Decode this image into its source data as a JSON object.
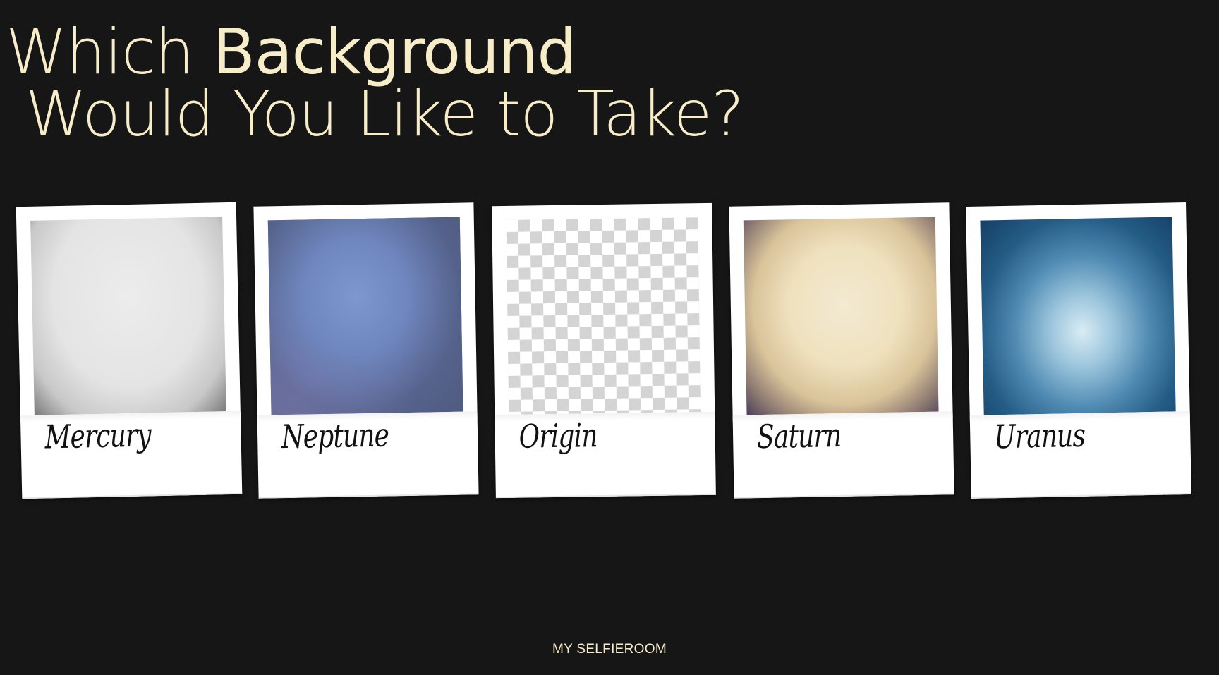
{
  "heading": {
    "line1_prefix": "Which ",
    "line1_emphasis": "Background",
    "line2": "Would You Like to Take?"
  },
  "backgrounds": [
    {
      "label": "Mercury"
    },
    {
      "label": "Neptune"
    },
    {
      "label": "Origin"
    },
    {
      "label": "Saturn"
    },
    {
      "label": "Uranus"
    }
  ],
  "colors": {
    "page_background": "#161616",
    "heading_text": "#f8edc9",
    "card": "#ffffff"
  },
  "footer": {
    "brand": "MY SELFIEROOM"
  }
}
